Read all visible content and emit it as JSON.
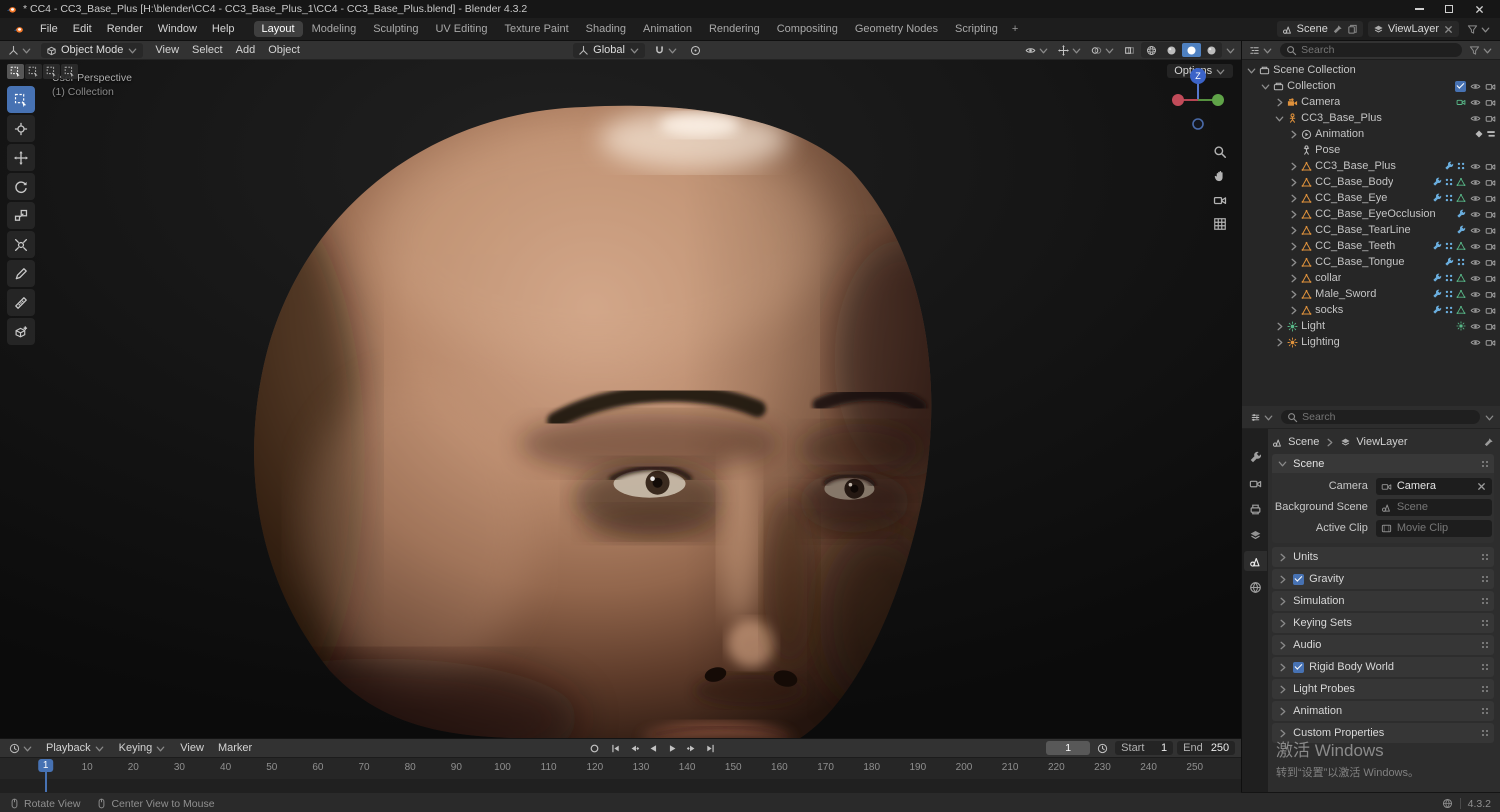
{
  "colors": {
    "accent": "#4772b3",
    "object_orange": "#e0923c",
    "data_green": "#58b888",
    "modifier_blue": "#6aaede",
    "world_red": "#d07070"
  },
  "app": {
    "title": "* CC4 - CC3_Base_Plus [H:\\blender\\CC4 - CC3_Base_Plus_1\\CC4 - CC3_Base_Plus.blend] - Blender 4.3.2",
    "window_controls": [
      "minimize",
      "maximize",
      "close"
    ]
  },
  "topbar": {
    "menus": [
      "File",
      "Edit",
      "Render",
      "Window",
      "Help"
    ],
    "workspaces": [
      "Layout",
      "Modeling",
      "Sculpting",
      "UV Editing",
      "Texture Paint",
      "Shading",
      "Animation",
      "Rendering",
      "Compositing",
      "Geometry Nodes",
      "Scripting"
    ],
    "active_workspace": "Layout",
    "new_workspace_label": "+",
    "scene": {
      "label": "Scene"
    },
    "view_layer": {
      "label": "ViewLayer"
    }
  },
  "viewport": {
    "mode_selector": "Object Mode",
    "menus": [
      "View",
      "Select",
      "Add",
      "Object"
    ],
    "orientation": "Global",
    "options_label": "Options",
    "overlay_line1": "User Perspective",
    "overlay_line2": "(1) Collection",
    "gizmo_axis_label": "Z",
    "tools": [
      "select-box",
      "cursor",
      "move",
      "rotate",
      "scale",
      "transform",
      "annotate",
      "measure",
      "add-cube"
    ],
    "active_tool": "select-box",
    "nav_icons": [
      "zoom",
      "pan",
      "camera-view",
      "orthographic"
    ],
    "shading_modes": [
      "wireframe",
      "solid",
      "material",
      "rendered"
    ],
    "active_shading": "material"
  },
  "outliner": {
    "search_placeholder": "Search",
    "items": [
      {
        "label": "Scene Collection",
        "depth": 0,
        "icon": "collection",
        "arrow": "down",
        "badges": [],
        "checkbox": false,
        "eye": false,
        "render": false
      },
      {
        "label": "Collection",
        "depth": 1,
        "icon": "collection",
        "arrow": "down",
        "badges": [],
        "checkbox": true,
        "checked": true,
        "eye": true,
        "render": true
      },
      {
        "label": "Camera",
        "depth": 2,
        "icon": "camera",
        "arrow": "right",
        "badges": [
          "camera-data"
        ],
        "checkbox": false,
        "eye": true,
        "render": true
      },
      {
        "label": "CC3_Base_Plus",
        "depth": 2,
        "icon": "armature",
        "arrow": "down",
        "badges": [],
        "checkbox": false,
        "eye": true,
        "render": true
      },
      {
        "label": "Animation",
        "depth": 3,
        "icon": "anim",
        "arrow": "right",
        "badges": [
          "action",
          "nla"
        ],
        "checkbox": false,
        "eye": false,
        "render": false
      },
      {
        "label": "Pose",
        "depth": 3,
        "icon": "pose",
        "arrow": "none",
        "badges": [],
        "checkbox": false,
        "eye": false,
        "render": false
      },
      {
        "label": "CC3_Base_Plus",
        "depth": 3,
        "icon": "mesh",
        "arrow": "right",
        "badges": [
          "modifier",
          "vgroup"
        ],
        "checkbox": false,
        "eye": true,
        "render": true
      },
      {
        "label": "CC_Base_Body",
        "depth": 3,
        "icon": "mesh",
        "arrow": "right",
        "badges": [
          "modifier",
          "vgroup",
          "mesh-data"
        ],
        "checkbox": false,
        "eye": true,
        "render": true
      },
      {
        "label": "CC_Base_Eye",
        "depth": 3,
        "icon": "mesh",
        "arrow": "right",
        "badges": [
          "modifier",
          "vgroup",
          "mesh-data"
        ],
        "checkbox": false,
        "eye": true,
        "render": true
      },
      {
        "label": "CC_Base_EyeOcclusion",
        "depth": 3,
        "icon": "mesh",
        "arrow": "right",
        "badges": [
          "modifier"
        ],
        "checkbox": false,
        "eye": true,
        "render": true
      },
      {
        "label": "CC_Base_TearLine",
        "depth": 3,
        "icon": "mesh",
        "arrow": "right",
        "badges": [
          "modifier"
        ],
        "checkbox": false,
        "eye": true,
        "render": true
      },
      {
        "label": "CC_Base_Teeth",
        "depth": 3,
        "icon": "mesh",
        "arrow": "right",
        "badges": [
          "modifier",
          "vgroup",
          "mesh-data"
        ],
        "checkbox": false,
        "eye": true,
        "render": true
      },
      {
        "label": "CC_Base_Tongue",
        "depth": 3,
        "icon": "mesh",
        "arrow": "right",
        "badges": [
          "modifier",
          "vgroup"
        ],
        "checkbox": false,
        "eye": true,
        "render": true
      },
      {
        "label": "collar",
        "depth": 3,
        "icon": "mesh",
        "arrow": "right",
        "badges": [
          "modifier",
          "vgroup",
          "mesh-data"
        ],
        "checkbox": false,
        "eye": true,
        "render": true
      },
      {
        "label": "Male_Sword",
        "depth": 3,
        "icon": "mesh",
        "arrow": "right",
        "badges": [
          "modifier",
          "vgroup",
          "mesh-data"
        ],
        "checkbox": false,
        "eye": true,
        "render": true
      },
      {
        "label": "socks",
        "depth": 3,
        "icon": "mesh",
        "arrow": "right",
        "badges": [
          "modifier",
          "vgroup",
          "mesh-data"
        ],
        "checkbox": false,
        "eye": true,
        "render": true
      },
      {
        "label": "Light",
        "depth": 2,
        "icon": "light",
        "arrow": "right",
        "badges": [
          "light-data"
        ],
        "checkbox": false,
        "eye": true,
        "render": true
      },
      {
        "label": "Lighting",
        "depth": 2,
        "icon": "sun",
        "arrow": "right",
        "badges": [],
        "checkbox": false,
        "eye": true,
        "render": true
      }
    ]
  },
  "properties": {
    "search_placeholder": "Search",
    "breadcrumb": {
      "scene": "Scene",
      "view_layer": "ViewLayer"
    },
    "tabs": [
      "tool",
      "render",
      "output",
      "view-layer",
      "scene",
      "world"
    ],
    "active_tab": "scene",
    "scene_panel": {
      "title": "Scene",
      "fields": [
        {
          "label": "Camera",
          "value": "Camera",
          "icon": "camera",
          "clearable": true,
          "muted": false
        },
        {
          "label": "Background Scene",
          "value": "Scene",
          "icon": "scene",
          "clearable": false,
          "muted": true
        },
        {
          "label": "Active Clip",
          "value": "Movie Clip",
          "icon": "clip",
          "clearable": false,
          "muted": true
        }
      ]
    },
    "panels": [
      {
        "label": "Units",
        "checkbox": false,
        "checked": false
      },
      {
        "label": "Gravity",
        "checkbox": true,
        "checked": true
      },
      {
        "label": "Simulation",
        "checkbox": false,
        "checked": false
      },
      {
        "label": "Keying Sets",
        "checkbox": false,
        "checked": false
      },
      {
        "label": "Audio",
        "checkbox": false,
        "checked": false
      },
      {
        "label": "Rigid Body World",
        "checkbox": true,
        "checked": true
      },
      {
        "label": "Light Probes",
        "checkbox": false,
        "checked": false
      },
      {
        "label": "Animation",
        "checkbox": false,
        "checked": false
      },
      {
        "label": "Custom Properties",
        "checkbox": false,
        "checked": false
      }
    ]
  },
  "timeline": {
    "menus": [
      "Playback",
      "Keying",
      "View",
      "Marker"
    ],
    "menu_dropdown": [
      true,
      true,
      false,
      false
    ],
    "transport": [
      "jump-start",
      "prev-keyframe",
      "play-reverse",
      "play",
      "next-keyframe",
      "jump-end"
    ],
    "current_frame": "1",
    "start_label": "Start",
    "start_value": "1",
    "end_label": "End",
    "end_value": "250",
    "ruler_frames": [
      10,
      20,
      30,
      40,
      50,
      60,
      70,
      80,
      90,
      100,
      110,
      120,
      130,
      140,
      150,
      160,
      170,
      180,
      190,
      200,
      210,
      220,
      230,
      240,
      250
    ]
  },
  "status_bar": {
    "hints": [
      "Rotate View",
      "Center View to Mouse"
    ],
    "version": "4.3.2"
  },
  "watermark": {
    "line1": "激活 Windows",
    "line2": "转到“设置”以激活 Windows。"
  }
}
